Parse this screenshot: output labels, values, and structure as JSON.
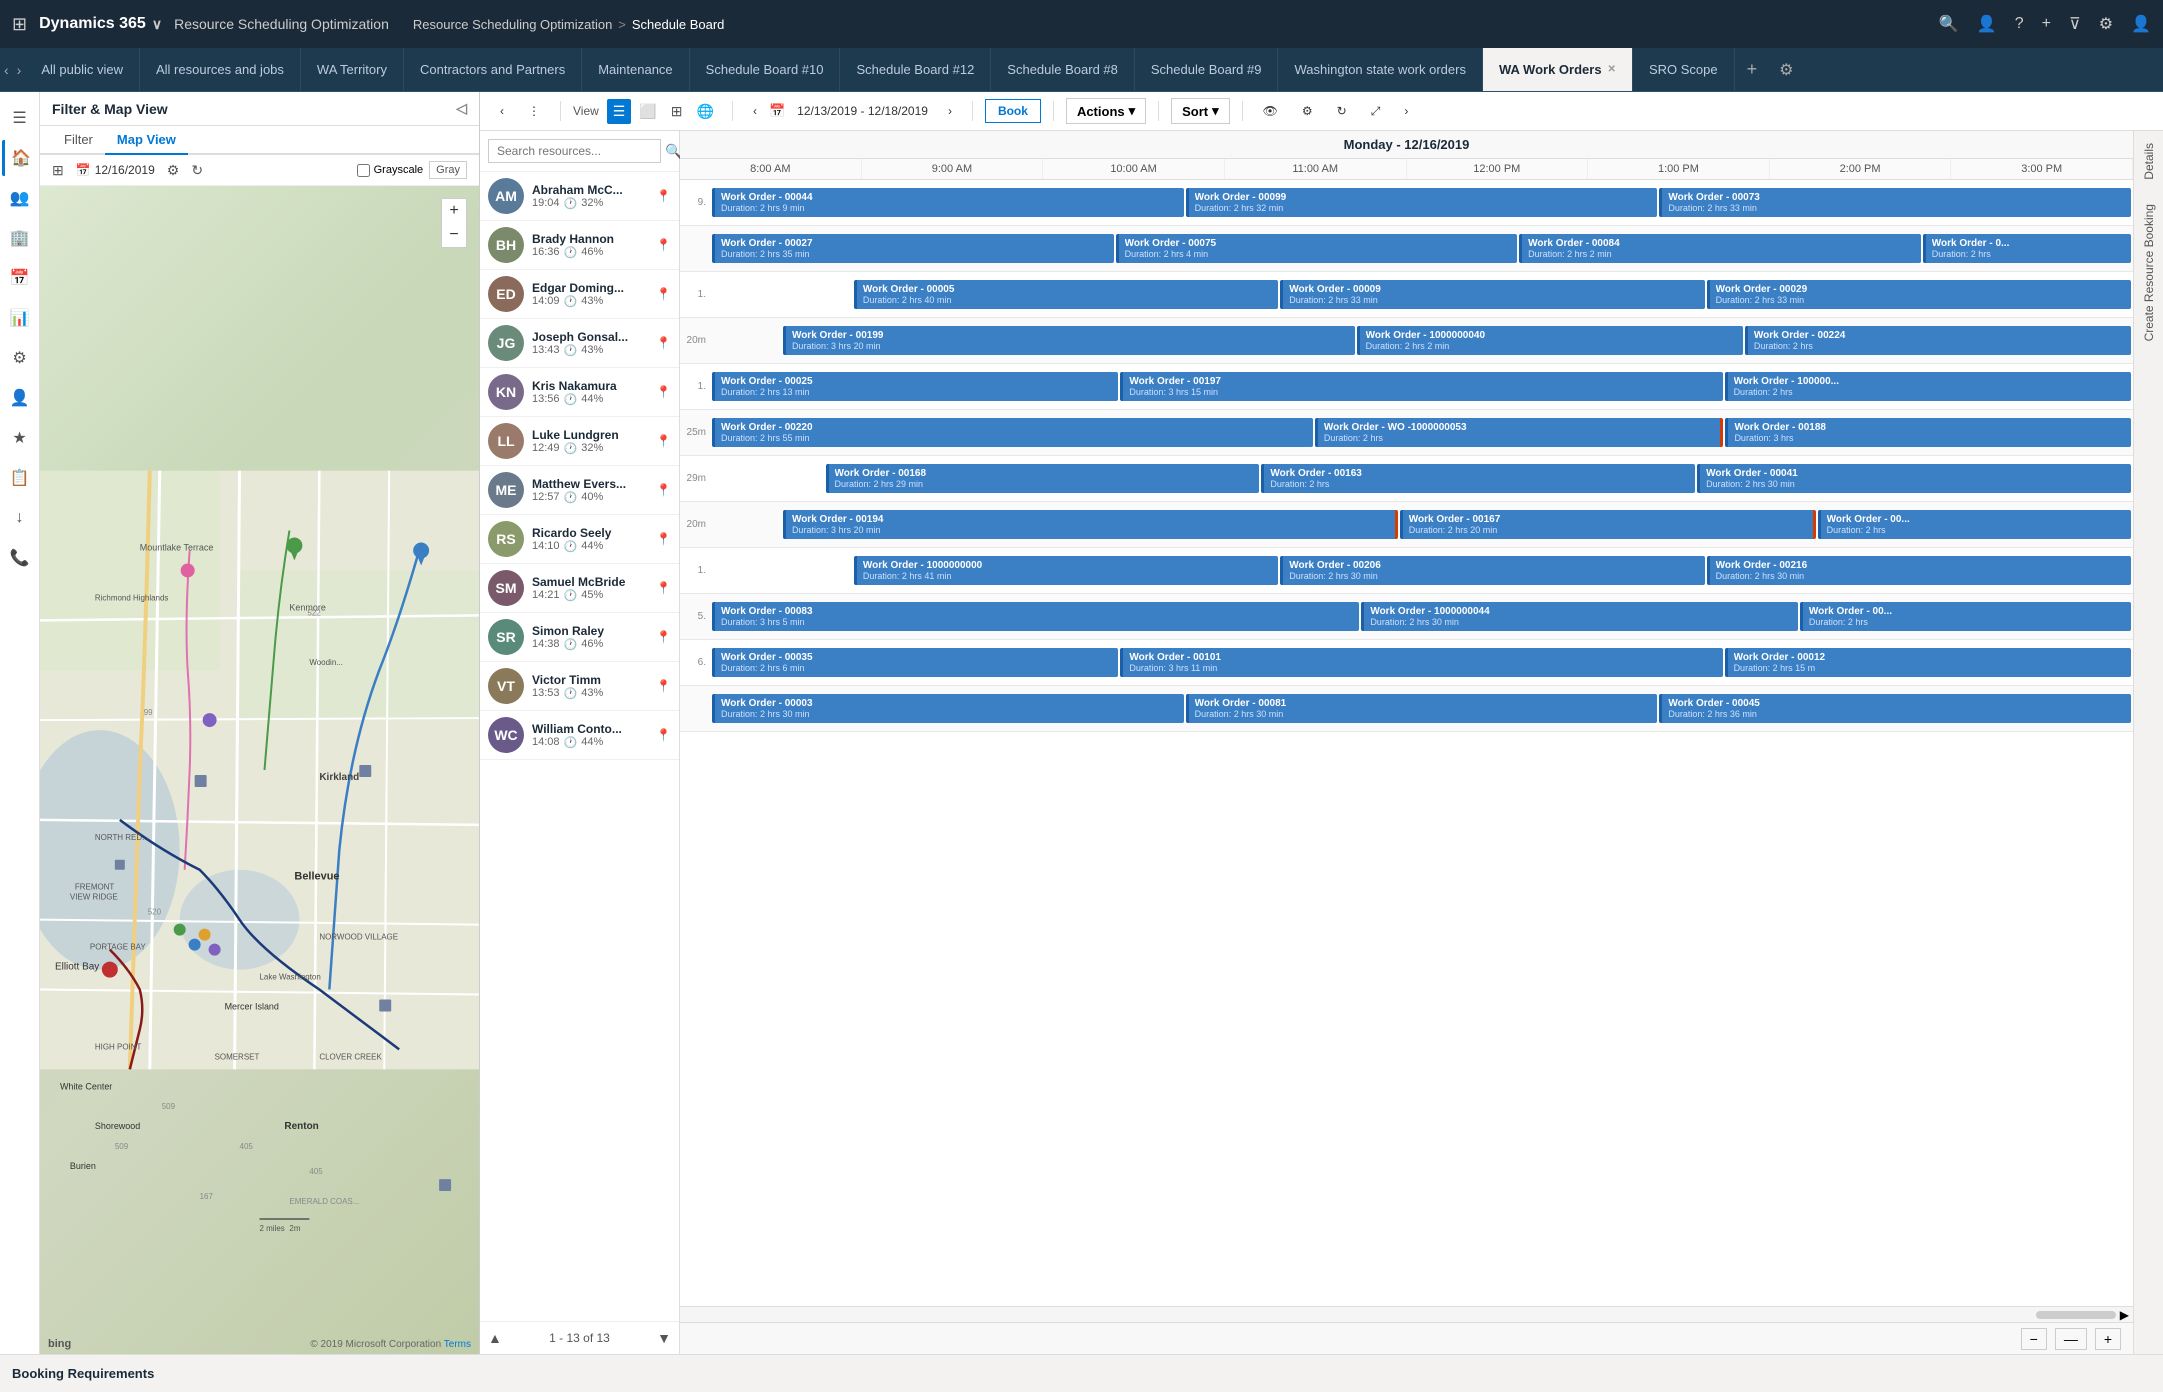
{
  "topnav": {
    "brand": "Dynamics 365",
    "app_name": "Resource Scheduling Optimization",
    "breadcrumb_parent": "Resource Scheduling Optimization",
    "breadcrumb_sep": ">",
    "breadcrumb_current": "Schedule Board",
    "icons": [
      "search",
      "contact",
      "help-outline",
      "add",
      "filter",
      "settings",
      "person"
    ]
  },
  "tabs": [
    {
      "id": "all-public",
      "label": "All public view",
      "active": false
    },
    {
      "id": "all-resources",
      "label": "All resources and jobs",
      "active": false
    },
    {
      "id": "wa-territory",
      "label": "WA Territory",
      "active": false
    },
    {
      "id": "contractors",
      "label": "Contractors and Partners",
      "active": false
    },
    {
      "id": "maintenance",
      "label": "Maintenance",
      "active": false
    },
    {
      "id": "schedule-10",
      "label": "Schedule Board #10",
      "active": false
    },
    {
      "id": "schedule-12",
      "label": "Schedule Board #12",
      "active": false
    },
    {
      "id": "schedule-8",
      "label": "Schedule Board #8",
      "active": false
    },
    {
      "id": "schedule-9",
      "label": "Schedule Board #9",
      "active": false
    },
    {
      "id": "wa-work-orders",
      "label": "Washington state work orders",
      "active": false
    },
    {
      "id": "wa-work-orders-2",
      "label": "WA Work Orders",
      "active": true
    },
    {
      "id": "sro-scope",
      "label": "SRO Scope",
      "active": false
    }
  ],
  "filter_map": {
    "title": "Filter & Map View",
    "tabs": [
      "Filter",
      "Map View"
    ],
    "active_tab": "Map View",
    "date": "12/16/2019",
    "grayscale_label": "Grayscale",
    "gray_label": "Gray",
    "bing_label": "bing",
    "copyright": "© 2019 Microsoft Corporation",
    "terms": "Terms"
  },
  "resources": {
    "search_placeholder": "Search resources...",
    "items": [
      {
        "id": "r1",
        "name": "Abraham McC...",
        "time": "19:04",
        "pct": "32%",
        "initials": "AM",
        "color": "#5a7a9a"
      },
      {
        "id": "r2",
        "name": "Brady Hannon",
        "time": "16:36",
        "pct": "46%",
        "initials": "BH",
        "color": "#7a8a6a"
      },
      {
        "id": "r3",
        "name": "Edgar Doming...",
        "time": "14:09",
        "pct": "43%",
        "initials": "ED",
        "color": "#8a6a5a"
      },
      {
        "id": "r4",
        "name": "Joseph Gonsal...",
        "time": "13:43",
        "pct": "43%",
        "initials": "JG",
        "color": "#6a8a7a"
      },
      {
        "id": "r5",
        "name": "Kris Nakamura",
        "time": "13:56",
        "pct": "44%",
        "initials": "KN",
        "color": "#7a6a8a"
      },
      {
        "id": "r6",
        "name": "Luke Lundgren",
        "time": "12:49",
        "pct": "32%",
        "initials": "LL",
        "color": "#9a7a6a"
      },
      {
        "id": "r7",
        "name": "Matthew Evers...",
        "time": "12:57",
        "pct": "40%",
        "initials": "ME",
        "color": "#6a7a8a"
      },
      {
        "id": "r8",
        "name": "Ricardo Seely",
        "time": "14:10",
        "pct": "44%",
        "initials": "RS",
        "color": "#8a9a6a"
      },
      {
        "id": "r9",
        "name": "Samuel McBride",
        "time": "14:21",
        "pct": "45%",
        "initials": "SM",
        "color": "#7a5a6a"
      },
      {
        "id": "r10",
        "name": "Simon Raley",
        "time": "14:38",
        "pct": "46%",
        "initials": "SR",
        "color": "#5a8a7a"
      },
      {
        "id": "r11",
        "name": "Victor Timm",
        "time": "13:53",
        "pct": "43%",
        "initials": "VT",
        "color": "#8a7a5a"
      },
      {
        "id": "r12",
        "name": "William Conto...",
        "time": "14:08",
        "pct": "44%",
        "initials": "WC",
        "color": "#6a5a8a"
      }
    ],
    "pagination": "1 - 13 of 13"
  },
  "schedule": {
    "date_header": "Monday - 12/16/2019",
    "date_range": "12/13/2019 - 12/18/2019",
    "time_slots": [
      "8:00 AM",
      "9:00 AM",
      "10:00 AM",
      "11:00 AM",
      "12:00 PM",
      "1:00 PM",
      "2:00 PM",
      "3:00 PM"
    ],
    "book_label": "Book",
    "actions_label": "Actions",
    "sort_label": "Sort",
    "rows": [
      {
        "label": "9.",
        "blocks": [
          {
            "id": "wo-44",
            "title": "Work Order - 00044",
            "duration": "Duration: 2 hrs 9 min",
            "width": 2,
            "red": false
          },
          {
            "id": "wo-99",
            "title": "Work Order - 00099",
            "duration": "Duration: 2 hrs 32 min",
            "width": 2,
            "red": false
          },
          {
            "id": "wo-73",
            "title": "Work Order - 00073",
            "duration": "Duration: 2 hrs 33 min",
            "width": 2,
            "red": false
          }
        ]
      },
      {
        "label": "",
        "blocks": [
          {
            "id": "wo-27",
            "title": "Work Order - 00027",
            "duration": "Duration: 2 hrs 35 min",
            "width": 2,
            "red": false
          },
          {
            "id": "wo-75",
            "title": "Work Order - 00075",
            "duration": "Duration: 2 hrs 4 min",
            "width": 2,
            "red": false
          },
          {
            "id": "wo-84",
            "title": "Work Order - 00084",
            "duration": "Duration: 2 hrs 2 min",
            "width": 2,
            "red": false
          },
          {
            "id": "wo-xx1",
            "title": "Work Order - 0...",
            "duration": "Duration: 2 hrs",
            "width": 1,
            "red": false
          }
        ]
      },
      {
        "label": "1.",
        "blocks": [
          {
            "id": "wo-5",
            "title": "Work Order - 00005",
            "duration": "Duration: 2 hrs 40 min",
            "width": 2,
            "red": false
          },
          {
            "id": "wo-9",
            "title": "Work Order - 00009",
            "duration": "Duration: 2 hrs 33 min",
            "width": 2,
            "red": false
          },
          {
            "id": "wo-29",
            "title": "Work Order - 00029",
            "duration": "Duration: 2 hrs 33 min",
            "width": 2,
            "red": false
          }
        ]
      },
      {
        "label": "20m",
        "blocks": [
          {
            "id": "wo-199",
            "title": "Work Order - 00199",
            "duration": "Duration: 3 hrs 20 min",
            "width": 2,
            "red": false
          },
          {
            "id": "wo-1000000040",
            "title": "Work Order - 1000000040",
            "duration": "Duration: 2 hrs 2 min",
            "width": 2,
            "red": false
          },
          {
            "id": "wo-224",
            "title": "Work Order - 00224",
            "duration": "Duration: 2 hrs",
            "width": 2,
            "red": false
          }
        ]
      },
      {
        "label": "1.",
        "blocks": [
          {
            "id": "wo-25",
            "title": "Work Order - 00025",
            "duration": "Duration: 2 hrs 13 min",
            "width": 2,
            "red": false
          },
          {
            "id": "wo-197",
            "title": "Work Order - 00197",
            "duration": "Duration: 3 hrs 15 min",
            "width": 2,
            "red": false
          },
          {
            "id": "wo-100000-r",
            "title": "Work Order - 100000...",
            "duration": "Duration: 2 hrs",
            "width": 2,
            "red": false
          }
        ]
      },
      {
        "label": "25m",
        "blocks": [
          {
            "id": "wo-220",
            "title": "Work Order - 00220",
            "duration": "Duration: 2 hrs 55 min",
            "width": 2,
            "red": false
          },
          {
            "id": "wo-wo53",
            "title": "Work Order - WO -1000000053",
            "duration": "Duration: 2 hrs",
            "width": 2,
            "red": true
          },
          {
            "id": "wo-188",
            "title": "Work Order - 00188",
            "duration": "Duration: 3 hrs",
            "width": 2,
            "red": false
          }
        ]
      },
      {
        "label": "29m",
        "blocks": [
          {
            "id": "wo-168",
            "title": "Work Order - 00168",
            "duration": "Duration: 2 hrs 29 min",
            "width": 2,
            "red": false
          },
          {
            "id": "wo-163",
            "title": "Work Order - 00163",
            "duration": "Duration: 2 hrs",
            "width": 2,
            "red": false
          },
          {
            "id": "wo-41",
            "title": "Work Order - 00041",
            "duration": "Duration: 2 hrs 30 min",
            "width": 2,
            "red": false
          }
        ]
      },
      {
        "label": "20m",
        "blocks": [
          {
            "id": "wo-194",
            "title": "Work Order - 00194",
            "duration": "Duration: 3 hrs 20 min",
            "width": 2,
            "red": true
          },
          {
            "id": "wo-167",
            "title": "Work Order - 00167",
            "duration": "Duration: 2 hrs 20 min",
            "width": 2,
            "red": true
          },
          {
            "id": "wo-00-r",
            "title": "Work Order - 00...",
            "duration": "Duration: 2 hrs",
            "width": 1,
            "red": false
          }
        ]
      },
      {
        "label": "1.",
        "blocks": [
          {
            "id": "wo-1000000000",
            "title": "Work Order - 1000000000",
            "duration": "Duration: 2 hrs 41 min",
            "width": 2,
            "red": false
          },
          {
            "id": "wo-206",
            "title": "Work Order - 00206",
            "duration": "Duration: 2 hrs 30 min",
            "width": 2,
            "red": false
          },
          {
            "id": "wo-216",
            "title": "Work Order - 00216",
            "duration": "Duration: 2 hrs 30 min",
            "width": 2,
            "red": false
          }
        ]
      },
      {
        "label": "5.",
        "blocks": [
          {
            "id": "wo-83",
            "title": "Work Order - 00083",
            "duration": "Duration: 3 hrs 5 min",
            "width": 2,
            "red": false
          },
          {
            "id": "wo-1000000044",
            "title": "Work Order - 1000000044",
            "duration": "Duration: 2 hrs 30 min",
            "width": 2,
            "red": false
          },
          {
            "id": "wo-00-s",
            "title": "Work Order - 00...",
            "duration": "Duration: 2 hrs",
            "width": 1,
            "red": false
          }
        ]
      },
      {
        "label": "6.",
        "blocks": [
          {
            "id": "wo-35",
            "title": "Work Order - 00035",
            "duration": "Duration: 2 hrs 6 min",
            "width": 2,
            "red": false
          },
          {
            "id": "wo-101",
            "title": "Work Order - 00101",
            "duration": "Duration: 3 hrs 11 min",
            "width": 2,
            "red": false
          },
          {
            "id": "wo-0012",
            "title": "Work Order - 00012",
            "duration": "Duration: 2 hrs 15 m",
            "width": 2,
            "red": false
          }
        ]
      },
      {
        "label": "",
        "blocks": [
          {
            "id": "wo-3",
            "title": "Work Order - 00003",
            "duration": "Duration: 2 hrs 30 min",
            "width": 2,
            "red": false
          },
          {
            "id": "wo-81",
            "title": "Work Order - 00081",
            "duration": "Duration: 2 hrs 30 min",
            "width": 2,
            "red": false
          },
          {
            "id": "wo-45",
            "title": "Work Order - 00045",
            "duration": "Duration: 2 hrs 36 min",
            "width": 2,
            "red": false
          }
        ]
      }
    ]
  },
  "sidebar_icons": [
    "home",
    "contacts",
    "accounts",
    "calendar",
    "chart",
    "settings",
    "people",
    "star",
    "clipboard",
    "download",
    "phone"
  ],
  "bottom_bar": {
    "label": "Booking Requirements"
  },
  "right_panel": {
    "details_label": "Details",
    "create_label": "Create Resource Booking"
  },
  "zoom_in": "+",
  "zoom_out": "−",
  "divider_btn": "—"
}
